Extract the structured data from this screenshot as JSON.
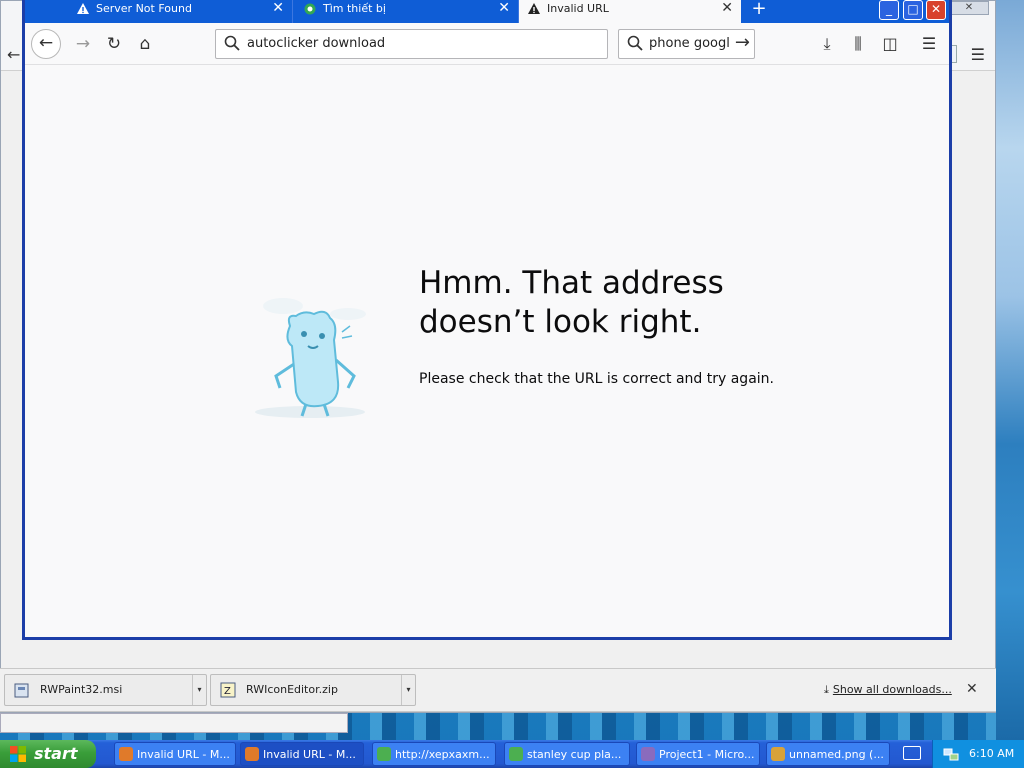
{
  "browser": {
    "tabs": [
      {
        "label": "Server Not Found",
        "icon": "warning-icon",
        "active": false
      },
      {
        "label": "Tìm thiết bị",
        "icon": "google-icon",
        "active": false
      },
      {
        "label": "Invalid URL",
        "icon": "warning-icon",
        "active": true
      }
    ],
    "new_tab": "+",
    "url_value": "autoclicker download",
    "search_value": "phone google"
  },
  "error_page": {
    "title": "Hmm. That address doesn’t look right.",
    "description": "Please check that the URL is correct and try again."
  },
  "downloads": {
    "items": [
      {
        "name": "RWPaint32.msi"
      },
      {
        "name": "RWIconEditor.zip"
      }
    ],
    "show_all": "Show all downloads..."
  },
  "taskbar": {
    "start_label": "start",
    "tasks": [
      {
        "label": "Invalid URL - M..."
      },
      {
        "label": "Invalid URL - M..."
      },
      {
        "label": "http://xepxaxm..."
      },
      {
        "label": "stanley cup pla..."
      },
      {
        "label": "Project1 - Micro..."
      },
      {
        "label": "unnamed.png (..."
      }
    ],
    "clock": "6:10 AM"
  },
  "colors": {
    "xp_blue": "#0f5dd6",
    "start_green": "#3a9e3a",
    "page_bg": "#f9f9fa"
  }
}
